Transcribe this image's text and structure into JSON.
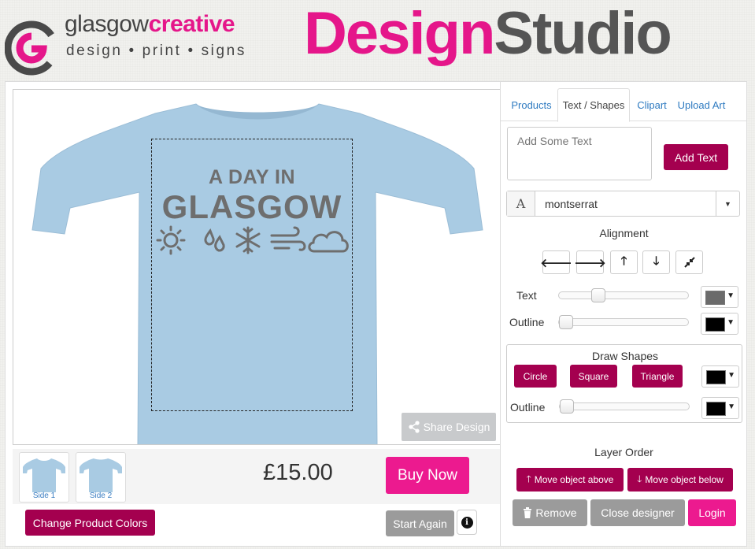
{
  "header": {
    "logo_word_grey": "glasgow",
    "logo_word_pink": "creative",
    "logo_tagline": "design • print • signs",
    "title_pink": "Design",
    "title_grey": "Studio"
  },
  "canvas": {
    "design_line1": "A DAY IN",
    "design_line2": "GLASGOW",
    "share_label": "Share Design",
    "tshirt_color": "#a9cbe3",
    "design_color": "#6e6e6e"
  },
  "product_strip": {
    "thumbs": [
      {
        "label": "Side 1"
      },
      {
        "label": "Side 2"
      }
    ],
    "price": "£15.00",
    "buy_label": "Buy Now"
  },
  "footer_left": {
    "change_colors_label": "Change Product Colors",
    "start_again_label": "Start Again"
  },
  "panel": {
    "tabs": [
      {
        "label": "Products"
      },
      {
        "label": "Text / Shapes"
      },
      {
        "label": "Clipart"
      },
      {
        "label": "Upload Art"
      }
    ],
    "active_tab": "Text / Shapes",
    "text_input_placeholder": "Add Some Text",
    "add_text_label": "Add Text",
    "font_glyph": "A",
    "font_value": "montserrat",
    "alignment_label": "Alignment",
    "text_label": "Text",
    "outline_label": "Outline",
    "text_slider_value": 0.28,
    "outline_slider_value": 0.0,
    "text_color": "#6b6b6b",
    "outline_color": "#000000",
    "draw_shapes_label": "Draw Shapes",
    "shape_buttons": [
      "Circle",
      "Square",
      "Triangle"
    ],
    "shape_fill_color": "#000000",
    "shape_outline_label": "Outline",
    "shape_outline_slider_value": 0.0,
    "shape_outline_color": "#000000",
    "layer_order_label": "Layer Order",
    "move_above_label": "Move object above",
    "move_below_label": "Move object below",
    "remove_label": "Remove",
    "close_label": "Close designer",
    "login_label": "Login"
  },
  "colors": {
    "pink": "#ec1a8f",
    "maroon": "#a4004f",
    "link_blue": "#2f7bc1"
  }
}
